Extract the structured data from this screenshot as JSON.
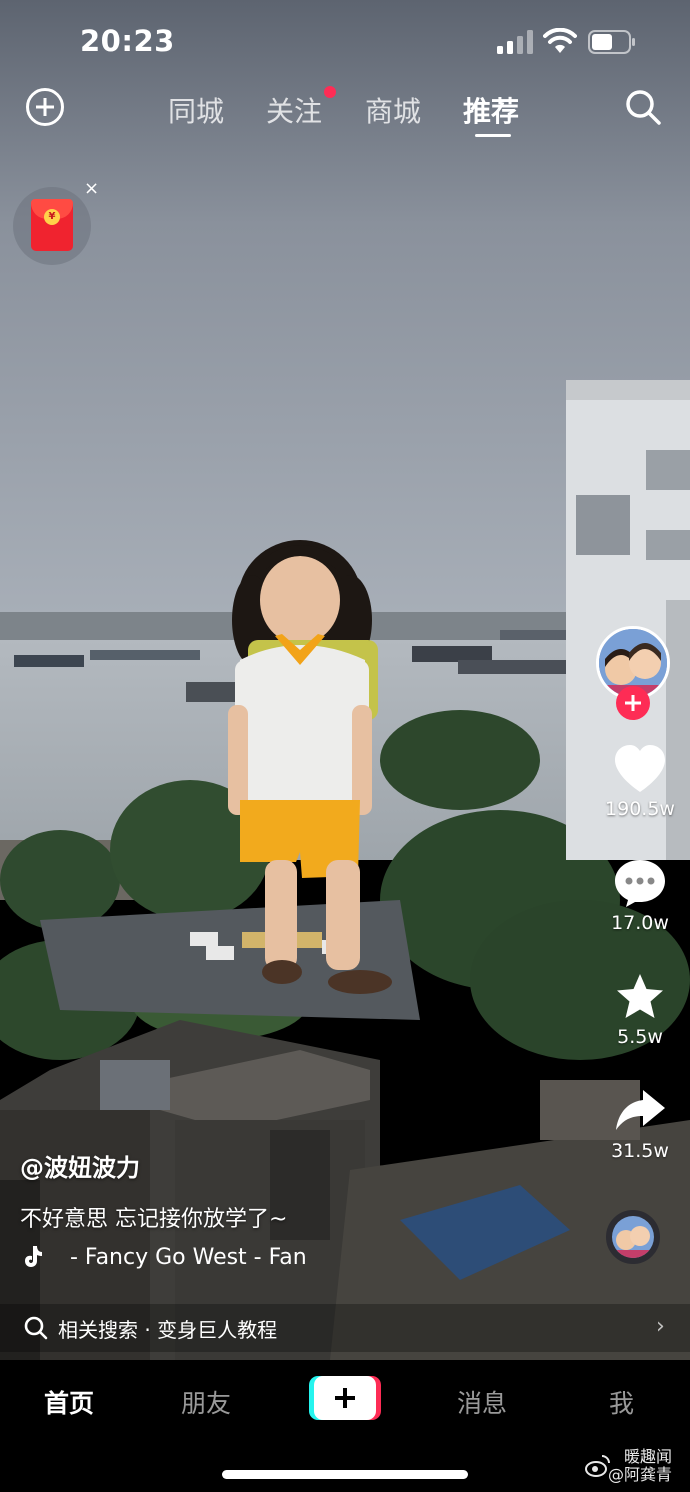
{
  "status_bar": {
    "time": "20:23"
  },
  "top_nav": {
    "tabs": [
      {
        "label": "同城"
      },
      {
        "label": "关注"
      },
      {
        "label": "商城"
      },
      {
        "label": "推荐"
      }
    ],
    "active_tab": "推荐"
  },
  "red_packet": {
    "close": "×"
  },
  "rail": {
    "likes": "190.5w",
    "comments": "17.0w",
    "favorites": "5.5w",
    "shares": "31.5w"
  },
  "caption": {
    "username": "@波妞波力",
    "description": "不好意思 忘记接你放学了~",
    "music": "- Fancy  Go West  - Fan"
  },
  "related": {
    "text": "相关搜索 · 变身巨人教程"
  },
  "bottom_nav": {
    "items": [
      {
        "label": "首页"
      },
      {
        "label": "朋友"
      },
      {
        "label": "消息"
      },
      {
        "label": "我"
      }
    ]
  },
  "watermark": {
    "line1": "暖趣闻",
    "line2": "@阿龚青"
  },
  "colors": {
    "accent": "#fe2c55",
    "cyan": "#25f4ee"
  }
}
